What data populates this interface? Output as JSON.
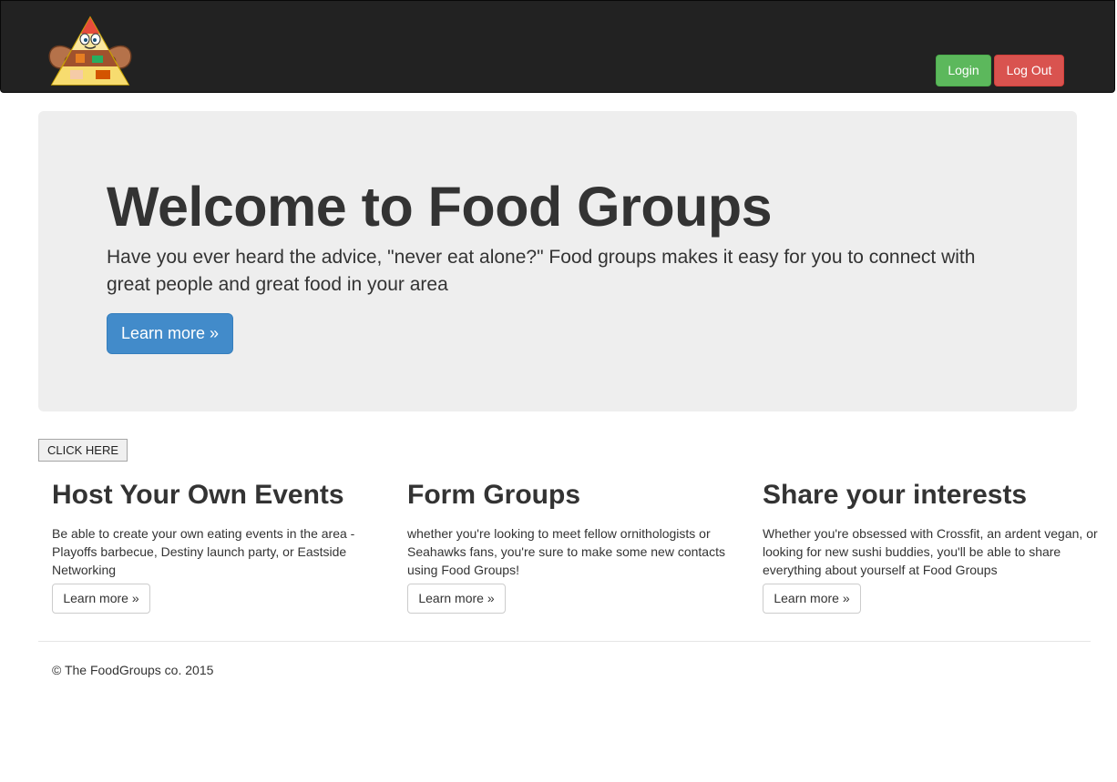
{
  "navbar": {
    "login_label": "Login",
    "logout_label": "Log Out",
    "login_color": "#5cb85c",
    "logout_color": "#d9534f"
  },
  "jumbotron": {
    "title": "Welcome to Food Groups",
    "text": "Have you ever heard the advice, \"never eat alone?\" Food groups makes it easy for you to connect with great people and great food in your area",
    "button_label": "Learn more »",
    "button_color": "#428bca"
  },
  "click_here_label": "CLICK HERE",
  "features": [
    {
      "title": "Host Your Own Events",
      "text": "Be able to create your own eating events in the area - Playoffs barbecue, Destiny launch party, or Eastside Networking",
      "button_label": "Learn more »"
    },
    {
      "title": "Form Groups",
      "text": "whether you're looking to meet fellow ornithologists or Seahawks fans, you're sure to make some new contacts using Food Groups!",
      "button_label": "Learn more »"
    },
    {
      "title": "Share your interests",
      "text": "Whether you're obsessed with Crossfit, an ardent vegan, or looking for new sushi buddies, you'll be able to share everything about yourself at Food Groups",
      "button_label": "Learn more »"
    }
  ],
  "footer": {
    "copyright": "© The FoodGroups co. 2015"
  },
  "icons": {
    "logo": "food-pyramid-logo"
  }
}
